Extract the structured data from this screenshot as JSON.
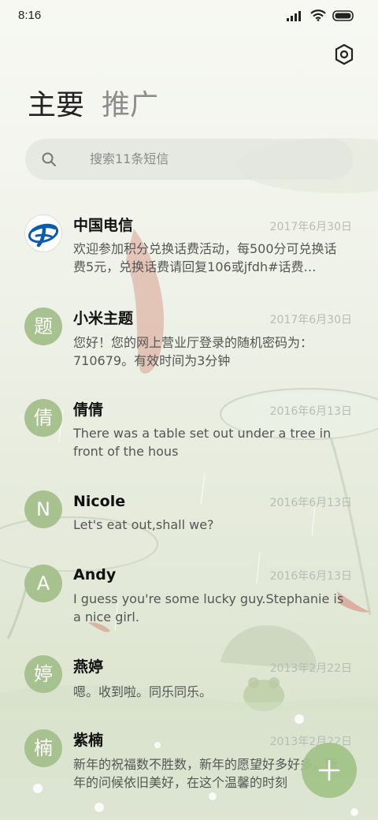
{
  "status_bar": {
    "time": "8:16",
    "icons": [
      "signal-icon",
      "wifi-icon",
      "battery-icon"
    ]
  },
  "header": {
    "settings_icon": "gear-icon",
    "tabs": [
      {
        "label": "主要",
        "active": true
      },
      {
        "label": "推广",
        "active": false
      }
    ]
  },
  "search": {
    "placeholder": "搜索11条短信"
  },
  "conversations": [
    {
      "avatar": "telecom-logo",
      "avatar_text": "",
      "name": "中国电信",
      "date": "2017年6月30日",
      "preview": "欢迎参加积分兑换话费活动，每500分可兑换话费5元，兑换话费请回复106或jfdh#话费…"
    },
    {
      "avatar_text": "题",
      "name": "小米主题",
      "date": "2017年6月30日",
      "preview": "您好！您的网上营业厅登录的随机密码为：710679。有效时间为3分钟"
    },
    {
      "avatar_text": "倩",
      "name": "倩倩",
      "date": "2016年6月13日",
      "preview": "There was a table set out under a tree in front of the hous"
    },
    {
      "avatar_text": "N",
      "name": "Nicole",
      "date": "2016年6月13日",
      "preview": "Let's eat out,shall we?"
    },
    {
      "avatar_text": "A",
      "name": "Andy",
      "date": "2016年6月13日",
      "preview": "I guess you're some lucky guy.Stephanie is a nice girl."
    },
    {
      "avatar_text": "婷",
      "name": "燕婷",
      "date": "2013年2月22日",
      "preview": "嗯。收到啦。同乐同乐。"
    },
    {
      "avatar_text": "楠",
      "name": "紫楠",
      "date": "2013年2月22日",
      "preview": "新年的祝福数不胜数，新年的愿望好多好多，新年的问候依旧美好，在这个温馨的时刻"
    }
  ],
  "fab": {
    "icon": "plus-icon",
    "color": "#a0c387"
  },
  "colors": {
    "avatar_green": "#a7c28f",
    "date_gray": "#b9bbb5"
  }
}
